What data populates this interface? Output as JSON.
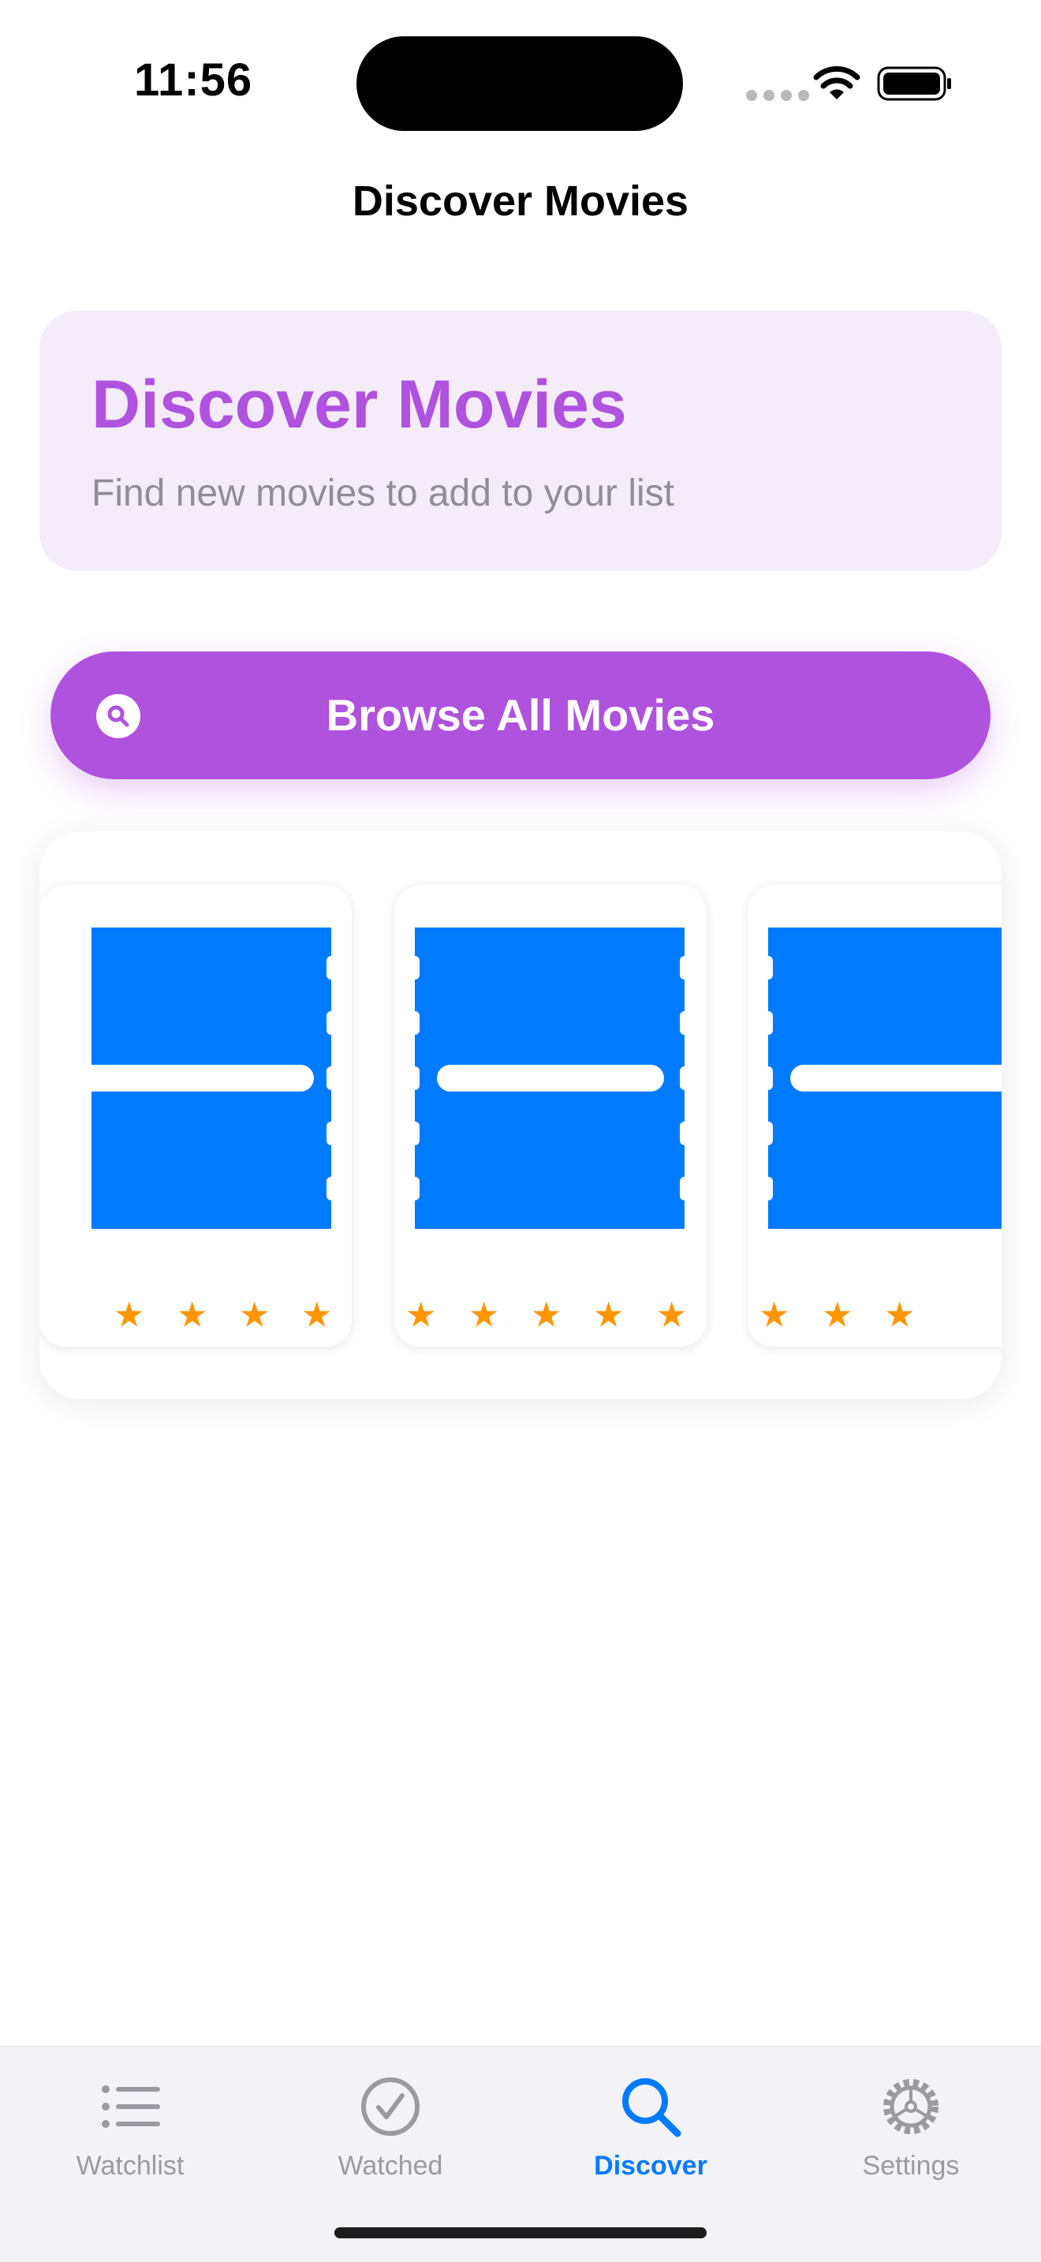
{
  "status_bar": {
    "time": "11:56"
  },
  "nav": {
    "title": "Discover Movies"
  },
  "header_card": {
    "title": "Discover Movies",
    "subtitle": "Find new movies to add to your list"
  },
  "browse_button": {
    "label": "Browse All Movies",
    "icon": "magnifying-glass-icon"
  },
  "movies": [
    {
      "poster_icon": "ticket-icon",
      "rating_stars": 4
    },
    {
      "poster_icon": "ticket-icon",
      "rating_stars": 5
    },
    {
      "poster_icon": "ticket-icon",
      "rating_stars": 3
    }
  ],
  "tab_bar": {
    "tabs": [
      {
        "label": "Watchlist",
        "icon": "list-icon",
        "active": false
      },
      {
        "label": "Watched",
        "icon": "checkmark-circle-icon",
        "active": false
      },
      {
        "label": "Discover",
        "icon": "magnifying-glass-icon",
        "active": true
      },
      {
        "label": "Settings",
        "icon": "gear-icon",
        "active": false
      }
    ]
  },
  "colors": {
    "accent_purple": "#af52de",
    "header_card_bg": "#f5ecfa",
    "poster_blue": "#007aff",
    "star_orange": "#ff9500",
    "tab_active": "#007aff",
    "tab_inactive": "#9a9aa0"
  }
}
